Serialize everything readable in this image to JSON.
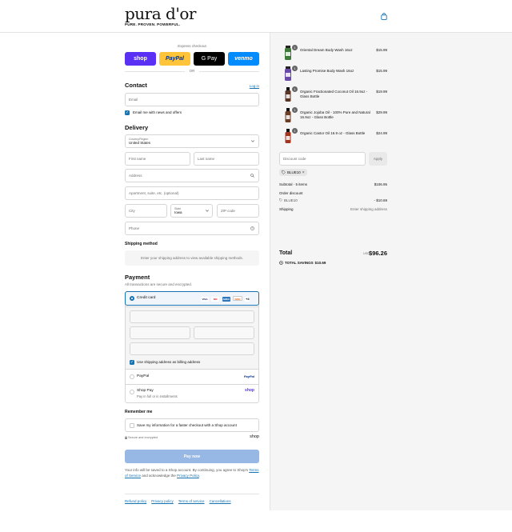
{
  "header": {
    "logo": "pura d'or",
    "tagline": "PURE. PROVEN. POWERFUL."
  },
  "express": {
    "label": "Express checkout",
    "buttons": [
      "shop",
      "PayPal",
      "G Pay",
      "venmo"
    ],
    "or": "OR"
  },
  "contact": {
    "title": "Contact",
    "login": "Log in",
    "email_placeholder": "Email",
    "newsletter_label": "Email me with news and offers"
  },
  "delivery": {
    "title": "Delivery",
    "country_label": "Country/Region",
    "country_value": "United States",
    "first_name": "First name",
    "last_name": "Last name",
    "address": "Address",
    "apartment": "Apartment, suite, etc. (optional)",
    "city": "City",
    "state_label": "State",
    "state_value": "Iowa",
    "zip": "ZIP code",
    "phone": "Phone"
  },
  "shipping_method": {
    "title": "Shipping method",
    "notice": "Enter your shipping address to view available shipping methods."
  },
  "payment": {
    "title": "Payment",
    "subtitle": "All transactions are secure and encrypted.",
    "credit_card": "Credit card",
    "card_brands": [
      "VISA",
      "MC",
      "AMEX",
      "DISC"
    ],
    "more_brands": "+4",
    "billing_same": "Use shipping address as billing address",
    "paypal": "PayPal",
    "paypal_logo": "PayPal",
    "shop_pay": "Shop Pay",
    "shop_pay_sub": "Pay in full or in installments",
    "shop_logo": "shop"
  },
  "remember": {
    "title": "Remember me",
    "save_label": "Save my information for a faster checkout with a Shop account",
    "secure": "Secure and encrypted",
    "shop_logo": "shop"
  },
  "pay_now": "Pay now",
  "legal": {
    "text1": "Your info will be saved to a Shop account. By continuing, you agree to Shop's",
    "terms": "Terms of Service",
    "text2": "and acknowledge the",
    "privacy": "Privacy Policy",
    "end": "."
  },
  "footer_links": [
    "Refund policy",
    "Privacy policy",
    "Terms of service",
    "Cancellations"
  ],
  "cart": {
    "items": [
      {
        "name": "Oriental Dream Body Wash 16oz",
        "price": "$15.99",
        "qty": "1",
        "color": "#3f7a3a"
      },
      {
        "name": "Lasting Promise Body Wash 16oz",
        "price": "$15.99",
        "qty": "1",
        "color": "#6a4aa8"
      },
      {
        "name": "Organic Fractionated Coconut Oil 16.9oz - Glass Bottle",
        "price": "$19.99",
        "qty": "1",
        "color": "#5a3422"
      },
      {
        "name": "Organic Jojoba Oil - 100% Pure and Natural 16.9oz - Glass Bottle",
        "price": "$29.99",
        "qty": "1",
        "color": "#6b3e25"
      },
      {
        "name": "Organic Castor Oil 16.9 oz - Glass Bottle",
        "price": "$24.99",
        "qty": "1",
        "color": "#a3341e"
      }
    ],
    "discount_placeholder": "Discount code",
    "apply": "Apply",
    "applied_code": "BLUE10",
    "subtotal_label": "Subtotal · 5 items",
    "subtotal": "$106.95",
    "order_discount_label": "Order discount",
    "discount_code": "BLUE10",
    "discount_amount": "- $10.69",
    "shipping_label": "Shipping",
    "shipping_value": "Enter shipping address",
    "total_label": "Total",
    "currency": "USD",
    "total": "$96.26",
    "savings_label": "TOTAL SAVINGS",
    "savings": "$10.69"
  }
}
